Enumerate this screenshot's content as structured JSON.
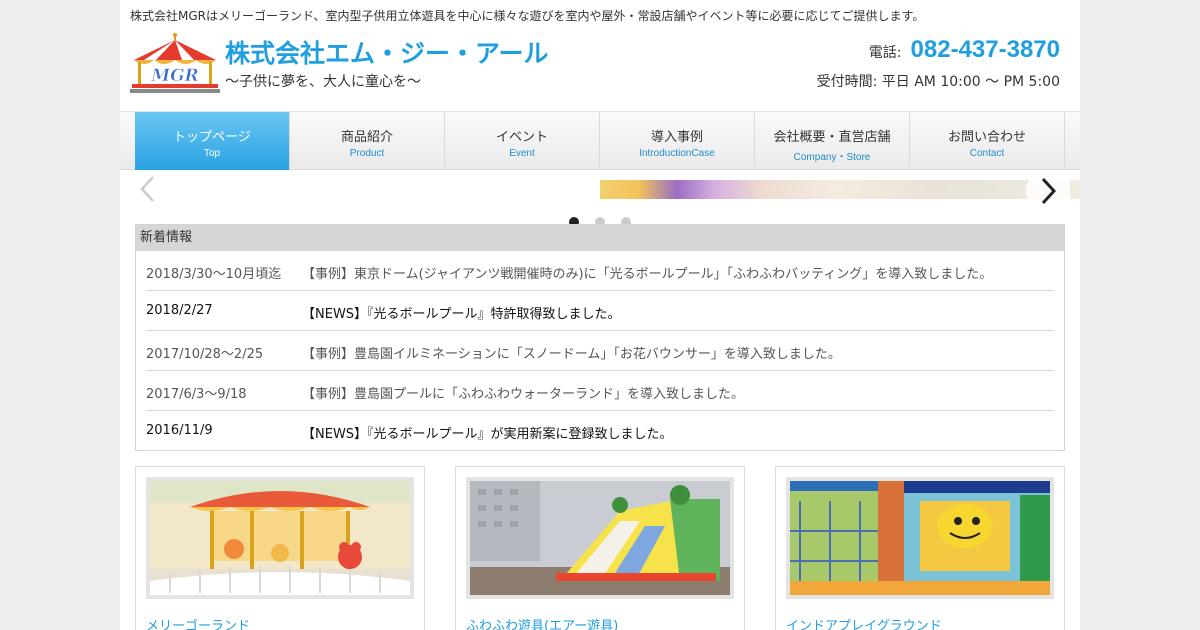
{
  "header": {
    "tagline": "株式会社MGRはメリーゴーランド、室内型子供用立体遊具を中心に様々な遊びを室内や屋外・常設店舗やイベント等に必要に応じてご提供します。",
    "company_name": "株式会社エム・ジー・アール",
    "slogan": "～子供に夢を、大人に童心を～",
    "phone_label": "電話:",
    "phone_number": "082-437-3870",
    "hours": "受付時間: 平日 AM 10:00 〜 PM 5:00",
    "logo_text": "MGR"
  },
  "nav": {
    "items": [
      {
        "label": "トップページ",
        "sublabel": "Top",
        "active": true
      },
      {
        "label": "商品紹介",
        "sublabel": "Product"
      },
      {
        "label": "イベント",
        "sublabel": "Event"
      },
      {
        "label": "導入事例",
        "sublabel": "IntroductionCase"
      },
      {
        "label": "会社概要・直営店舗",
        "sublabel": "Company・Store"
      },
      {
        "label": "お問い合わせ",
        "sublabel": "Contact"
      }
    ]
  },
  "slider": {
    "prev_icon": "chevron-left-icon",
    "next_icon": "chevron-right-icon",
    "dot_count": 3,
    "active_dot": 0
  },
  "news": {
    "heading": "新着情報",
    "items": [
      {
        "date": "2018/3/30〜10月頃迄",
        "text": "【事例】東京ドーム(ジャイアンツ戦開催時のみ)に「光るボールプール」「ふわふわバッティング」を導入致しました。"
      },
      {
        "date": "2018/2/27",
        "text": "【NEWS】『光るボールプール』特許取得致しました。"
      },
      {
        "date": "2017/10/28〜2/25",
        "text": "【事例】豊島園イルミネーションに「スノードーム」「お花バウンサー」を導入致しました。"
      },
      {
        "date": "2017/6/3〜9/18",
        "text": "【事例】豊島園プールに「ふわふわウォーターランド」を導入致しました。"
      },
      {
        "date": "2016/11/9",
        "text": "【NEWS】『光るボールプール』が実用新案に登録致しました。"
      }
    ]
  },
  "products": [
    {
      "label": "メリーゴーランド"
    },
    {
      "label": "ふわふわ遊具(エアー遊具)"
    },
    {
      "label": "インドアプレイグラウンド"
    }
  ],
  "colors": {
    "accent": "#1f9ee0",
    "nav_active": "#2aa3e3",
    "news_header": "#d6d6d6"
  }
}
